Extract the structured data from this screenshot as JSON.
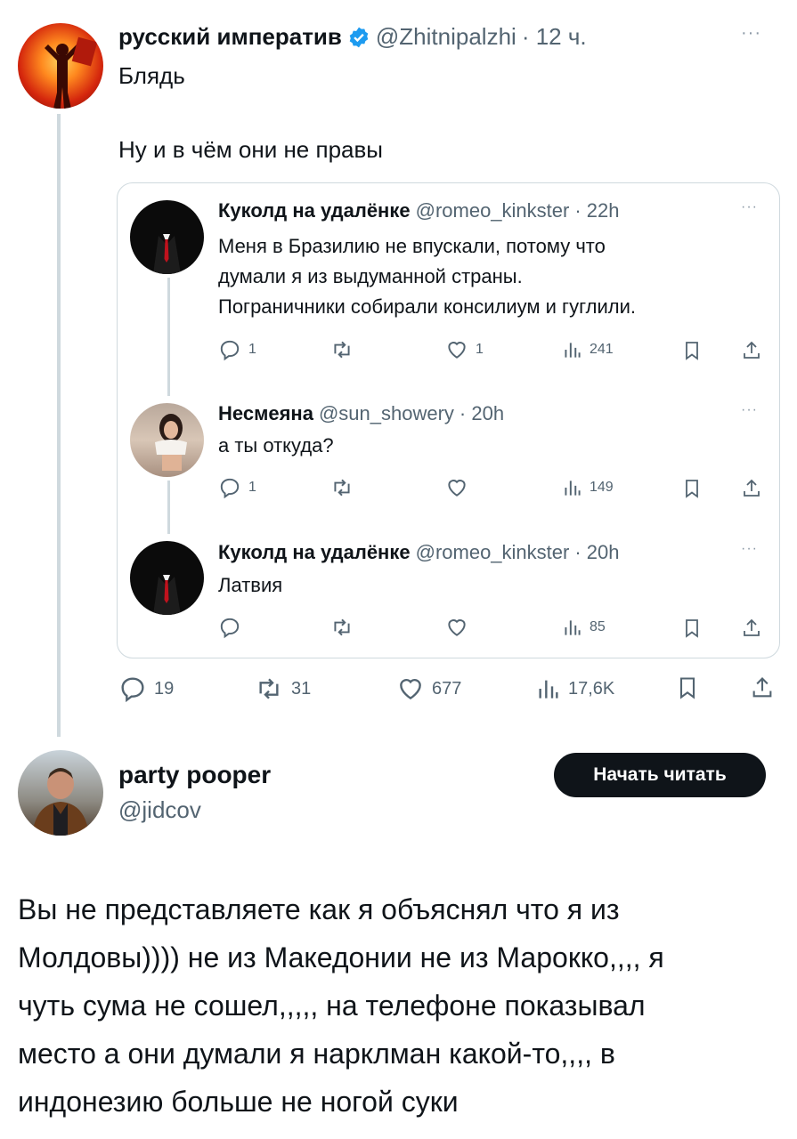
{
  "tweet": {
    "author_name": "русский императив",
    "handle": "@Zhitnipalzhi",
    "time": "· 12 ч.",
    "more": "···",
    "line1": "Блядь",
    "line2": "Ну и в чём они не правы",
    "stats": {
      "replies": "19",
      "reposts": "31",
      "likes": "677",
      "views": "17,6K"
    }
  },
  "quote": {
    "items": [
      {
        "name": "Куколд на удалёнке",
        "handle": "@romeo_kinkster",
        "time": "· 22h",
        "text_lines": [
          "Меня в Бразилию не впускали, потому что",
          "думали я из выдуманной страны.",
          "Пограничники собирали консилиум и гуглили."
        ],
        "stats": {
          "replies": "1",
          "reposts": "",
          "likes": "1",
          "views": "241"
        }
      },
      {
        "name": "Несмеяна",
        "handle": "@sun_showery",
        "time": "· 20h",
        "text_lines": [
          "а ты откуда?"
        ],
        "stats": {
          "replies": "1",
          "reposts": "",
          "likes": "",
          "views": "149"
        }
      },
      {
        "name": "Куколд на удалёнке",
        "handle": "@romeo_kinkster",
        "time": "· 20h",
        "text_lines": [
          "Латвия"
        ],
        "stats": {
          "replies": "",
          "reposts": "",
          "likes": "",
          "views": "85"
        }
      }
    ]
  },
  "reply_profile": {
    "name": "party pooper",
    "handle": "@jidcov",
    "follow_label": "Начать читать"
  },
  "reply_text": [
    "Вы не представляете как я объяснял что я из",
    "Молдовы)))) не из Македонии не из Марокко,,,, я",
    "чуть сума не сошел,,,,, на телефоне показывал",
    "место а они думали я нарклман какой-то,,,, в",
    "индонезию больше не ногой суки"
  ],
  "colors": {
    "verified": "#1d9bf0",
    "muted": "#536471",
    "border": "#cfd9de"
  }
}
